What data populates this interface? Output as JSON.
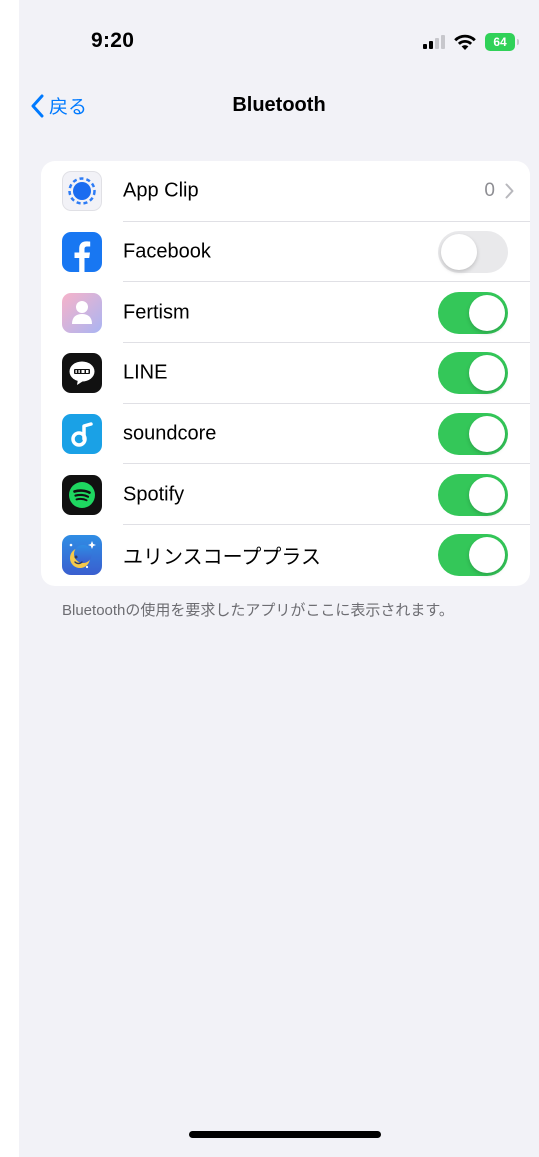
{
  "status_bar": {
    "time": "9:20",
    "battery": "64"
  },
  "nav": {
    "back_label": "戻る",
    "title": "Bluetooth"
  },
  "apps": [
    {
      "name": "App Clip",
      "detail": "0",
      "icon": "app-clip-icon",
      "type": "disclosure"
    },
    {
      "name": "Facebook",
      "icon": "facebook-icon",
      "type": "toggle",
      "enabled": false
    },
    {
      "name": "Fertism",
      "icon": "fertism-icon",
      "type": "toggle",
      "enabled": true
    },
    {
      "name": "LINE",
      "icon": "line-icon",
      "type": "toggle",
      "enabled": true
    },
    {
      "name": "soundcore",
      "icon": "soundcore-icon",
      "type": "toggle",
      "enabled": true
    },
    {
      "name": "Spotify",
      "icon": "spotify-icon",
      "type": "toggle",
      "enabled": true
    },
    {
      "name": "ユリンスコーププラス",
      "icon": "urinscope-plus-icon",
      "type": "toggle",
      "enabled": true
    }
  ],
  "footer_text": "Bluetoothの使用を要求したアプリがここに表示されます。",
  "colors": {
    "accent": "#007aff",
    "toggle_on": "#34c759",
    "toggle_off": "#e9e9eb",
    "battery": "#30d158",
    "background": "#f2f2f7"
  }
}
